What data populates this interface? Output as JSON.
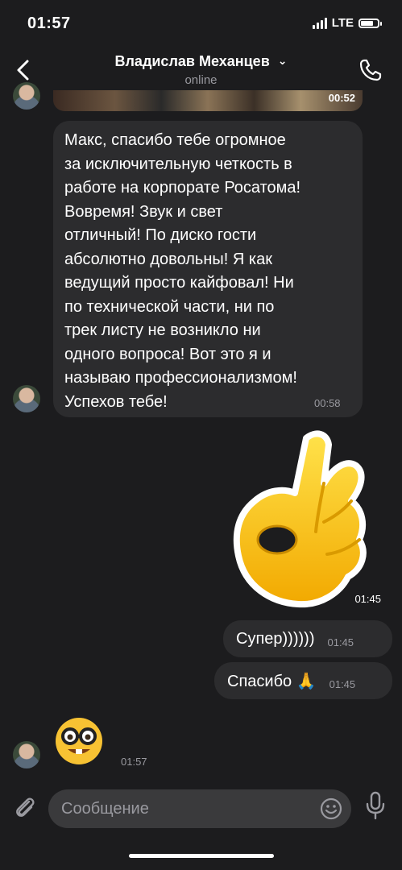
{
  "status_bar": {
    "time": "01:57",
    "network": "LTE",
    "battery_level": 0.7
  },
  "header": {
    "contact_name": "Владислав Механцев",
    "status": "online",
    "chevron": "⌄"
  },
  "messages": {
    "partial_media_time": "00:52",
    "incoming_text": "Макс, спасибо тебе огромное\nза исключительную четкость в\nработе на корпорате Росатома!\nВовремя! Звук и свет\nотличный! По диско гости\nабсолютно довольны! Я как\nведущий просто кайфовал! Ни\nпо технической части, ни по\nтрек листу не возникло ни\nодного вопроса! Вот это я и\nназываю профессионализмом!\nУспехов тебе!",
    "incoming_time": "00:58",
    "sticker_time": "01:45",
    "out1_text": "Супер))))))",
    "out1_time": "01:45",
    "out2_text": "Спасибо 🙏",
    "out2_time": "01:45",
    "nerd_time": "01:57"
  },
  "composer": {
    "placeholder": "Сообщение"
  },
  "icons": [
    "back-icon",
    "chevron-down-icon",
    "phone-icon",
    "paperclip-icon",
    "smile-icon",
    "microphone-icon",
    "ok-hand-sticker",
    "nerd-face-emoji"
  ],
  "colors": {
    "background": "#1c1c1e",
    "bubble": "#2c2c2e",
    "secondary_text": "#9a9aa0"
  }
}
